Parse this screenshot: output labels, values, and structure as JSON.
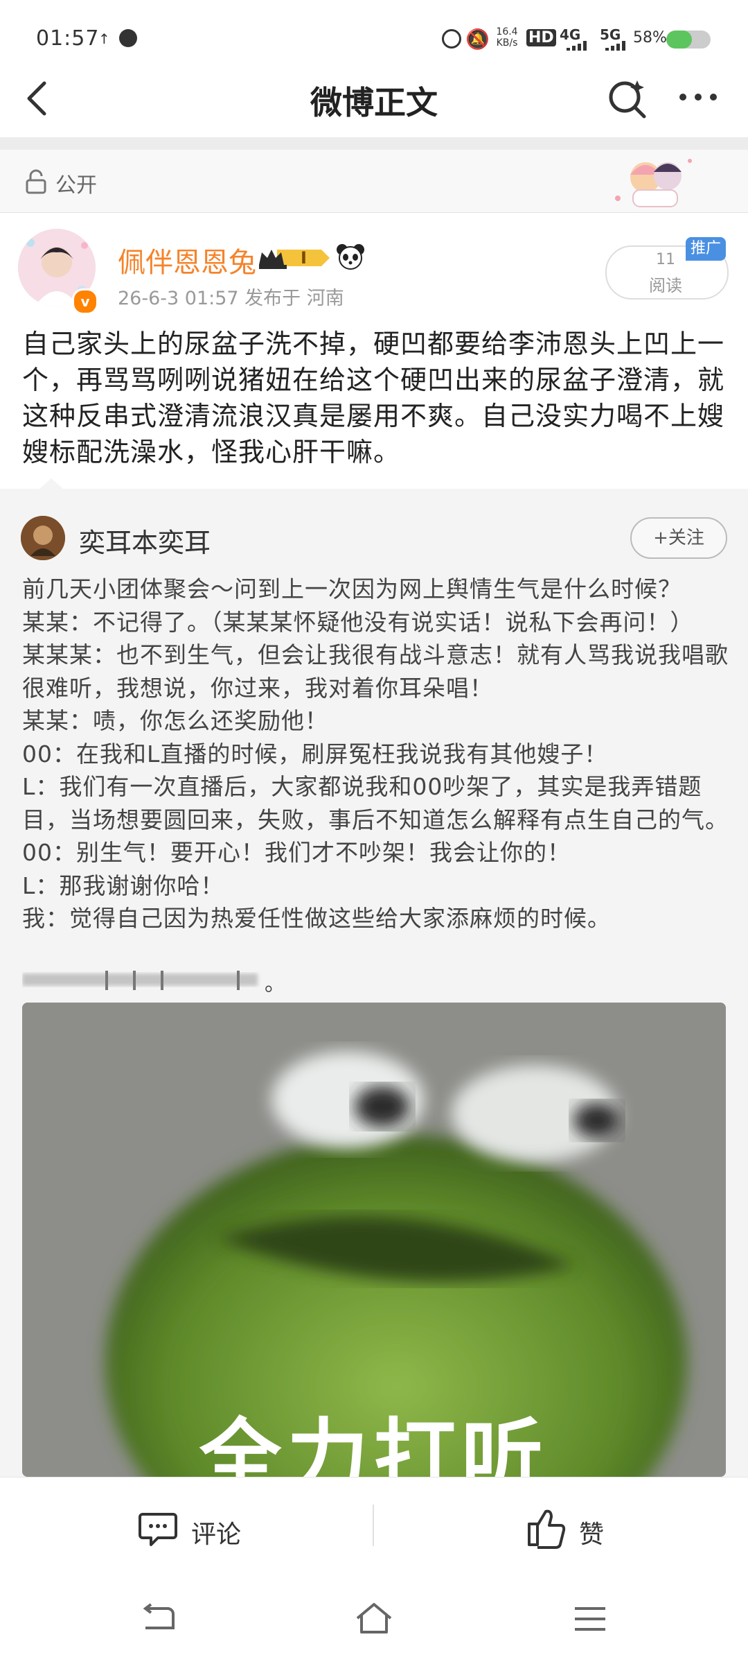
{
  "status_bar": {
    "time": "01:57",
    "net_speed_top": "16.4",
    "net_speed_bottom": "KB/s",
    "hd": "HD",
    "net1": "4G",
    "net2": "5G",
    "battery": "58%",
    "battery_level": 0.58
  },
  "nav": {
    "title": "微博正文"
  },
  "visibility": {
    "label": "公开"
  },
  "post": {
    "author": "佩伴恩恩兔",
    "member_badge": "I",
    "meta": "26-6-3 01:57  发布于 河南",
    "read_count": "11",
    "read_label": "阅读",
    "promo_tag": "推广",
    "text": "自己家头上的尿盆子洗不掉，硬凹都要给李沛恩头上凹上一个，再骂骂咧咧说猪妞在给这个硬凹出来的尿盆子澄清，就这种反串式澄清流浪汉真是屡用不爽。自己没实力喝不上嫂嫂标配洗澡水，怪我心肝干嘛。"
  },
  "repost": {
    "author": "奕耳本奕耳",
    "follow_label": "+关注",
    "lines": [
      "前几天小团体聚会～问到上一次因为网上舆情生气是什么时候？",
      "某某：不记得了。（某某某怀疑他没有说实话！说私下会再问！）",
      "某某某：也不到生气，但会让我很有战斗意志！就有人骂我说我唱歌很难听，我想说，你过来，我对着你耳朵唱！",
      "某某：啧，你怎么还奖励他！",
      "00：在我和L直播的时候，刷屏冤枉我说我有其他嫂子！",
      "L：我们有一次直播后，大家都说我和00吵架了，其实是我弄错题目，当场想要圆回来，失败，事后不知道怎么解释有点生自己的气。",
      "00：别生气！要开心！我们才不吵架！我会让你的！",
      "L：那我谢谢你哈！",
      "我：觉得自己因为热爱任性做这些给大家添麻烦的时候。"
    ],
    "blurred_tail": "。",
    "image_caption": "全力打听"
  },
  "actions": {
    "comment_label": "评论",
    "like_label": "赞"
  }
}
